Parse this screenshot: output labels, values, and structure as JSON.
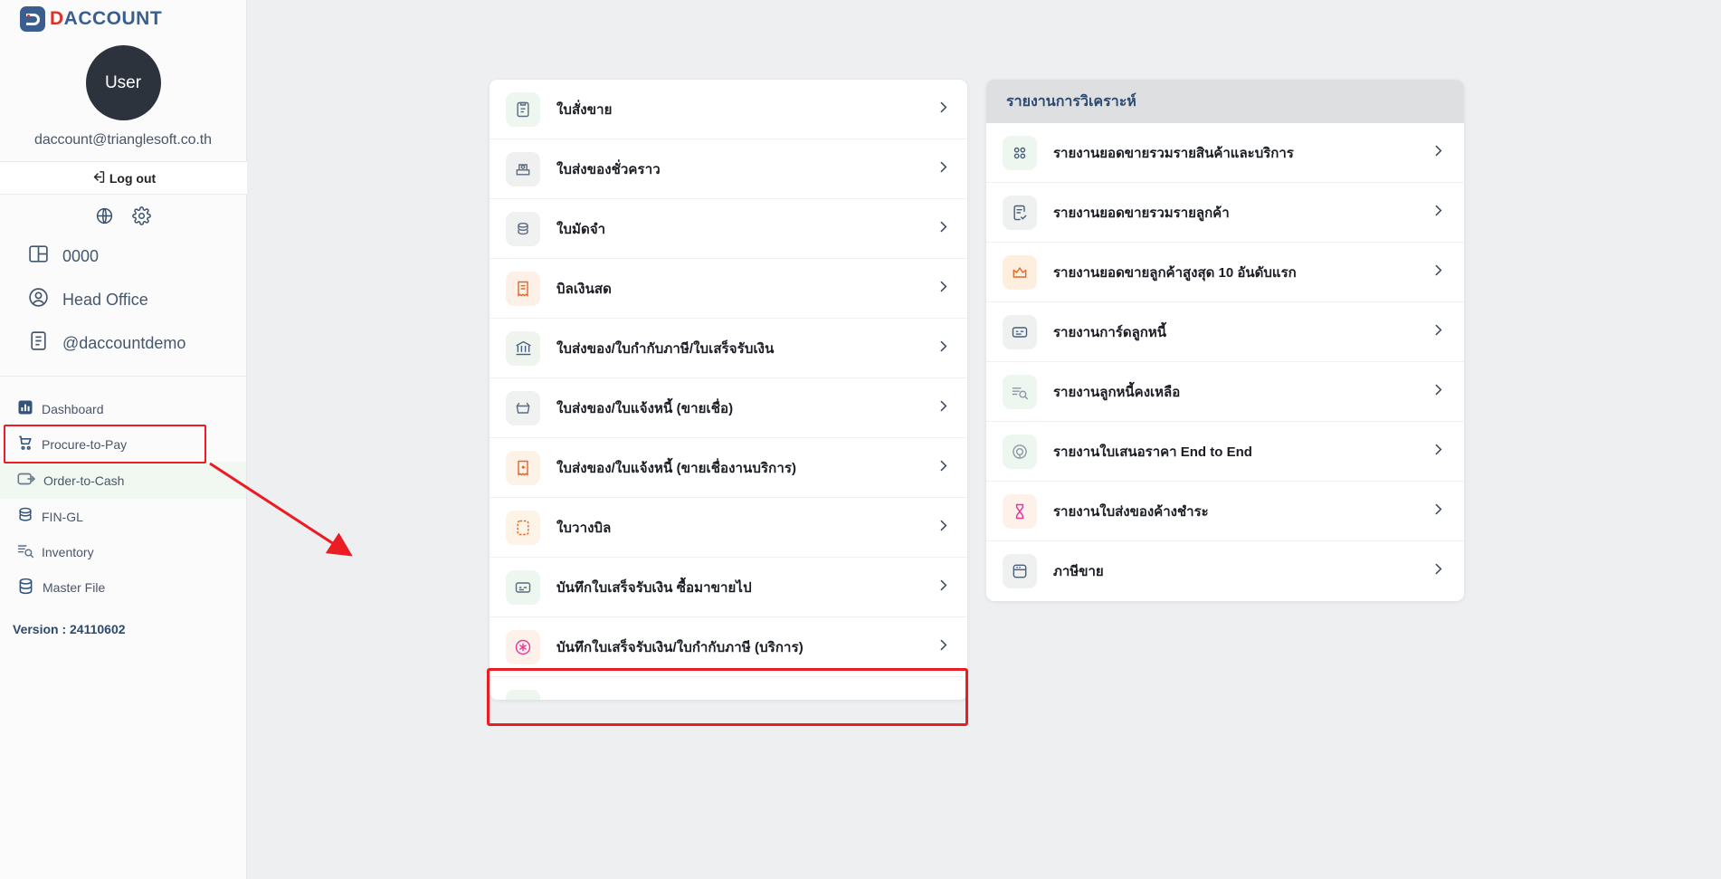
{
  "brand": {
    "logo_text_a": "D",
    "logo_text_b": "ACCOUNT",
    "accent_red": "#e03127",
    "accent_blue": "#3a5f8f"
  },
  "sidebar": {
    "avatar_label": "User",
    "user_email": "daccount@trianglesoft.co.th",
    "logout_label": "Log out",
    "quick_icons": [
      {
        "name": "globe-icon"
      },
      {
        "name": "gear-icon"
      }
    ],
    "meta_items": [
      {
        "icon": "layout-icon",
        "label": "0000"
      },
      {
        "icon": "user-circle-icon",
        "label": "Head Office"
      },
      {
        "icon": "document-icon",
        "label": "@daccountdemo"
      }
    ],
    "nav_items": [
      {
        "icon": "dashboard-icon",
        "label": "Dashboard",
        "active": false
      },
      {
        "icon": "cart-icon",
        "label": "Procure-to-Pay",
        "active": false
      },
      {
        "icon": "wallet-icon",
        "label": "Order-to-Cash",
        "active": true
      },
      {
        "icon": "coins-icon",
        "label": "FIN-GL",
        "active": false
      },
      {
        "icon": "list-search-icon",
        "label": "Inventory",
        "active": false
      },
      {
        "icon": "database-icon",
        "label": "Master File",
        "active": false
      }
    ],
    "version_label": "Version : 24110602"
  },
  "documents": {
    "rows": [
      {
        "icon": "clipboard-icon",
        "label": "ใบสั่งขาย",
        "tint": "#eef7ef",
        "stroke": "#5d6b7f",
        "highlighted": false
      },
      {
        "icon": "delivery-temp-icon",
        "label": "ใบส่งของชั่วคราว",
        "tint": "#eff1f0",
        "stroke": "#5d6b7f",
        "highlighted": false
      },
      {
        "icon": "coins-stack-icon",
        "label": "ใบมัดจำ",
        "tint": "#f0f1f1",
        "stroke": "#5d6b7f",
        "highlighted": false
      },
      {
        "icon": "receipt-icon",
        "label": "บิลเงินสด",
        "tint": "#fdf0e6",
        "stroke": "#e1692a",
        "highlighted": false
      },
      {
        "icon": "bank-icon",
        "label": "ใบส่งของ/ใบกำกับภาษี/ใบเสร็จรับเงิน",
        "tint": "#eff4ef",
        "stroke": "#4a5e7e",
        "highlighted": false
      },
      {
        "icon": "basket-icon",
        "label": "ใบส่งของ/ใบแจ้งหนี้ (ขายเชื่อ)",
        "tint": "#f0f1f1",
        "stroke": "#5d6b7f",
        "highlighted": false
      },
      {
        "icon": "return-note-icon",
        "label": "ใบส่งของ/ใบแจ้งหนี้ (ขายเชื่องานบริการ)",
        "tint": "#fdf2e8",
        "stroke": "#e1692a",
        "highlighted": false
      },
      {
        "icon": "billing-note-icon",
        "label": "ใบวางบิล",
        "tint": "#fdf3e6",
        "stroke": "#e1692a",
        "highlighted": false
      },
      {
        "icon": "card-icon",
        "label": "บันทึกใบเสร็จรับเงิน ซื้อมาขายไป",
        "tint": "#eef7ef",
        "stroke": "#5d6b7f",
        "highlighted": true
      },
      {
        "icon": "asterisk-circle-icon",
        "label": "บันทึกใบเสร็จรับเงิน/ใบกำกับภาษี (บริการ)",
        "tint": "#fdf1e9",
        "stroke": "#e6399b",
        "highlighted": false
      },
      {
        "icon": "partial-icon",
        "label": "",
        "tint": "#eef7ef",
        "stroke": "#5d6b7f",
        "highlighted": false
      }
    ]
  },
  "reports": {
    "header": "รายงานการวิเคราะห์",
    "rows": [
      {
        "icon": "grid-dots-icon",
        "label": "รายงานยอดขายรวมรายสินค้าและบริการ",
        "tint": "#eef7ef",
        "stroke": "#4a5e7e"
      },
      {
        "icon": "doc-check-icon",
        "label": "รายงานยอดขายรวมรายลูกค้า",
        "tint": "#eff1f0",
        "stroke": "#4a5e7e"
      },
      {
        "icon": "crown-icon",
        "label": "รายงานยอดขายลูกค้าสูงสุด 10 อันดับแรก",
        "tint": "#fdeede",
        "stroke": "#e1692a"
      },
      {
        "icon": "card-icon",
        "label": "รายงานการ์ดลูกหนี้",
        "tint": "#eff1f0",
        "stroke": "#4a5e7e"
      },
      {
        "icon": "list-search-icon",
        "label": "รายงานลูกหนี้คงเหลือ",
        "tint": "#eef7ef",
        "stroke": "#8d98a6"
      },
      {
        "icon": "target-icon",
        "label": "รายงานใบเสนอราคา End to End",
        "tint": "#eef7ef",
        "stroke": "#8d98a6"
      },
      {
        "icon": "hourglass-icon",
        "label": "รายงานใบส่งของค้างชำระ",
        "tint": "#fdf1e9",
        "stroke": "#e6399b"
      },
      {
        "icon": "tax-icon",
        "label": "ภาษีขาย",
        "tint": "#eff1f0",
        "stroke": "#4a5e7e"
      }
    ]
  },
  "annotations": {
    "highlight_color": "#ec1c24",
    "sidebar_highlight_target": "Order-to-Cash",
    "document_highlight_target": "บันทึกใบเสร็จรับเงิน ซื้อมาขายไป",
    "arrow_from": "Order-to-Cash",
    "arrow_to": "ใบวางบิล"
  }
}
